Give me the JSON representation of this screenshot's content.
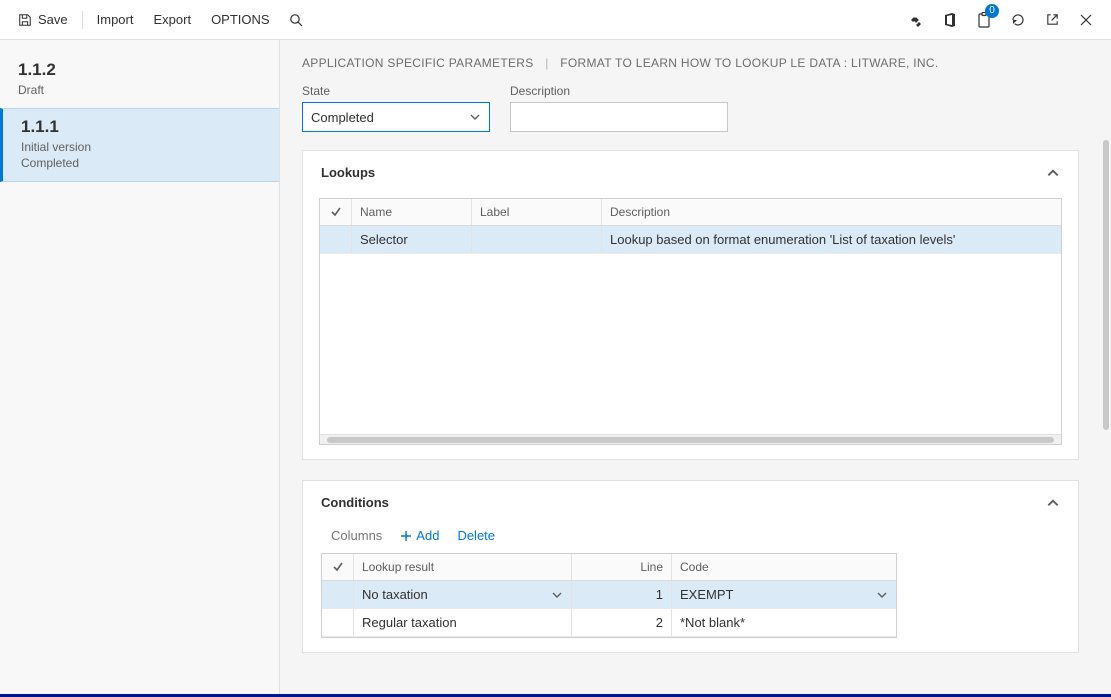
{
  "toolbar": {
    "save": "Save",
    "import": "Import",
    "export": "Export",
    "options": "OPTIONS",
    "notification_count": "0"
  },
  "sidebar": {
    "items": [
      {
        "version": "1.1.2",
        "line1": "Draft",
        "line2": ""
      },
      {
        "version": "1.1.1",
        "line1": "Initial version",
        "line2": "Completed"
      }
    ]
  },
  "header": {
    "crumb1": "APPLICATION SPECIFIC PARAMETERS",
    "crumb2": "FORMAT TO LEARN HOW TO LOOKUP LE DATA : LITWARE, INC."
  },
  "fields": {
    "state_label": "State",
    "state_value": "Completed",
    "description_label": "Description",
    "description_value": ""
  },
  "lookups": {
    "title": "Lookups",
    "columns": {
      "name": "Name",
      "label": "Label",
      "description": "Description"
    },
    "rows": [
      {
        "name": "Selector",
        "label": "",
        "description": "Lookup based on format enumeration 'List of taxation levels'"
      }
    ]
  },
  "conditions": {
    "title": "Conditions",
    "toolbar": {
      "columns": "Columns",
      "add": "Add",
      "delete": "Delete"
    },
    "columns": {
      "lookup_result": "Lookup result",
      "line": "Line",
      "code": "Code"
    },
    "rows": [
      {
        "lookup_result": "No taxation",
        "line": "1",
        "code": "EXEMPT"
      },
      {
        "lookup_result": "Regular taxation",
        "line": "2",
        "code": "*Not blank*"
      }
    ]
  }
}
